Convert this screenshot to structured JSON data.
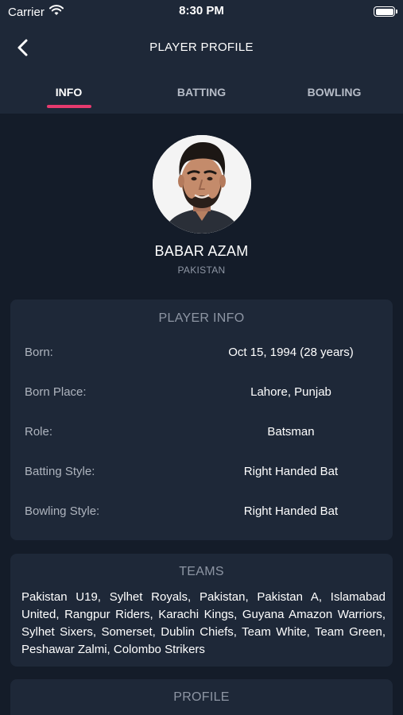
{
  "status_bar": {
    "carrier": "Carrier",
    "time": "8:30 PM",
    "battery_level": 1.0
  },
  "nav": {
    "title": "PLAYER PROFILE",
    "back_icon": "chevron-left-icon"
  },
  "tabs": [
    {
      "label": "INFO",
      "active": true
    },
    {
      "label": "BATTING",
      "active": false
    },
    {
      "label": "BOWLING",
      "active": false
    }
  ],
  "player": {
    "name": "BABAR AZAM",
    "country": "PAKISTAN"
  },
  "player_info": {
    "title": "PLAYER INFO",
    "rows": [
      {
        "label": "Born:",
        "value": "Oct 15, 1994 (28 years)"
      },
      {
        "label": "Born Place:",
        "value": "Lahore, Punjab"
      },
      {
        "label": "Role:",
        "value": "Batsman"
      },
      {
        "label": "Batting Style:",
        "value": "Right Handed Bat"
      },
      {
        "label": "Bowling Style:",
        "value": "Right Handed Bat"
      }
    ]
  },
  "teams": {
    "title": "TEAMS",
    "text": "Pakistan U19, Sylhet Royals, Pakistan, Pakistan A, Islamabad United, Rangpur Riders, Karachi Kings, Guyana Amazon Warriors, Sylhet Sixers, Somerset, Dublin Chiefs, Team White, Team Green, Peshawar Zalmi, Colombo Strikers"
  },
  "profile": {
    "title": "PROFILE"
  },
  "colors": {
    "background": "#141c29",
    "surface": "#1e2838",
    "accent": "#e73a6e",
    "muted_text": "#8e96a4"
  }
}
